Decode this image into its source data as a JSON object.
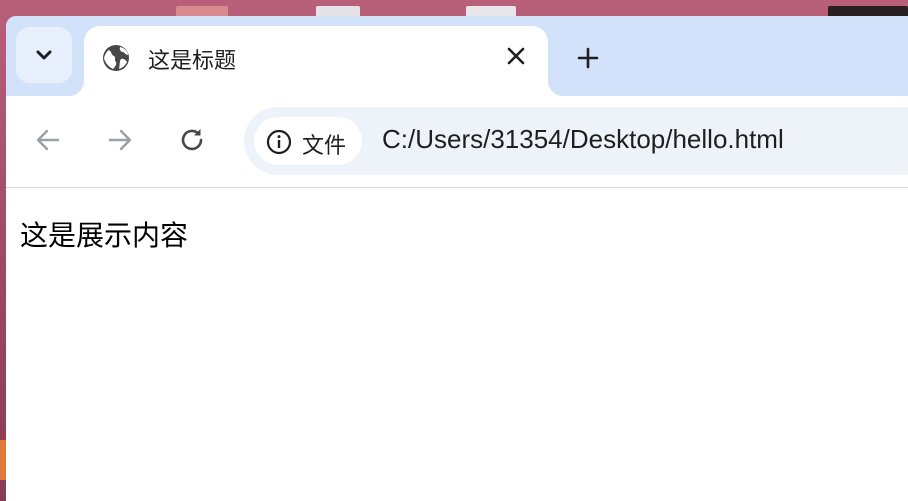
{
  "tab": {
    "title": "这是标题",
    "favicon": "globe-icon"
  },
  "toolbar": {
    "security_label": "文件",
    "url": "C:/Users/31354/Desktop/hello.html"
  },
  "page": {
    "body_text": "这是展示内容"
  },
  "icons": {
    "tab_search": "chevron-down-icon",
    "close": "close-icon",
    "new_tab": "plus-icon",
    "back": "arrow-left-icon",
    "forward": "arrow-right-icon",
    "reload": "reload-icon",
    "site_info": "info-icon"
  },
  "colors": {
    "tabstrip_bg": "#d3e2fb",
    "tab_search_bg": "#e7effd",
    "omnibox_bg": "#eef2f9",
    "text": "#1f1f1f",
    "disabled_icon": "#9aa0a6"
  }
}
